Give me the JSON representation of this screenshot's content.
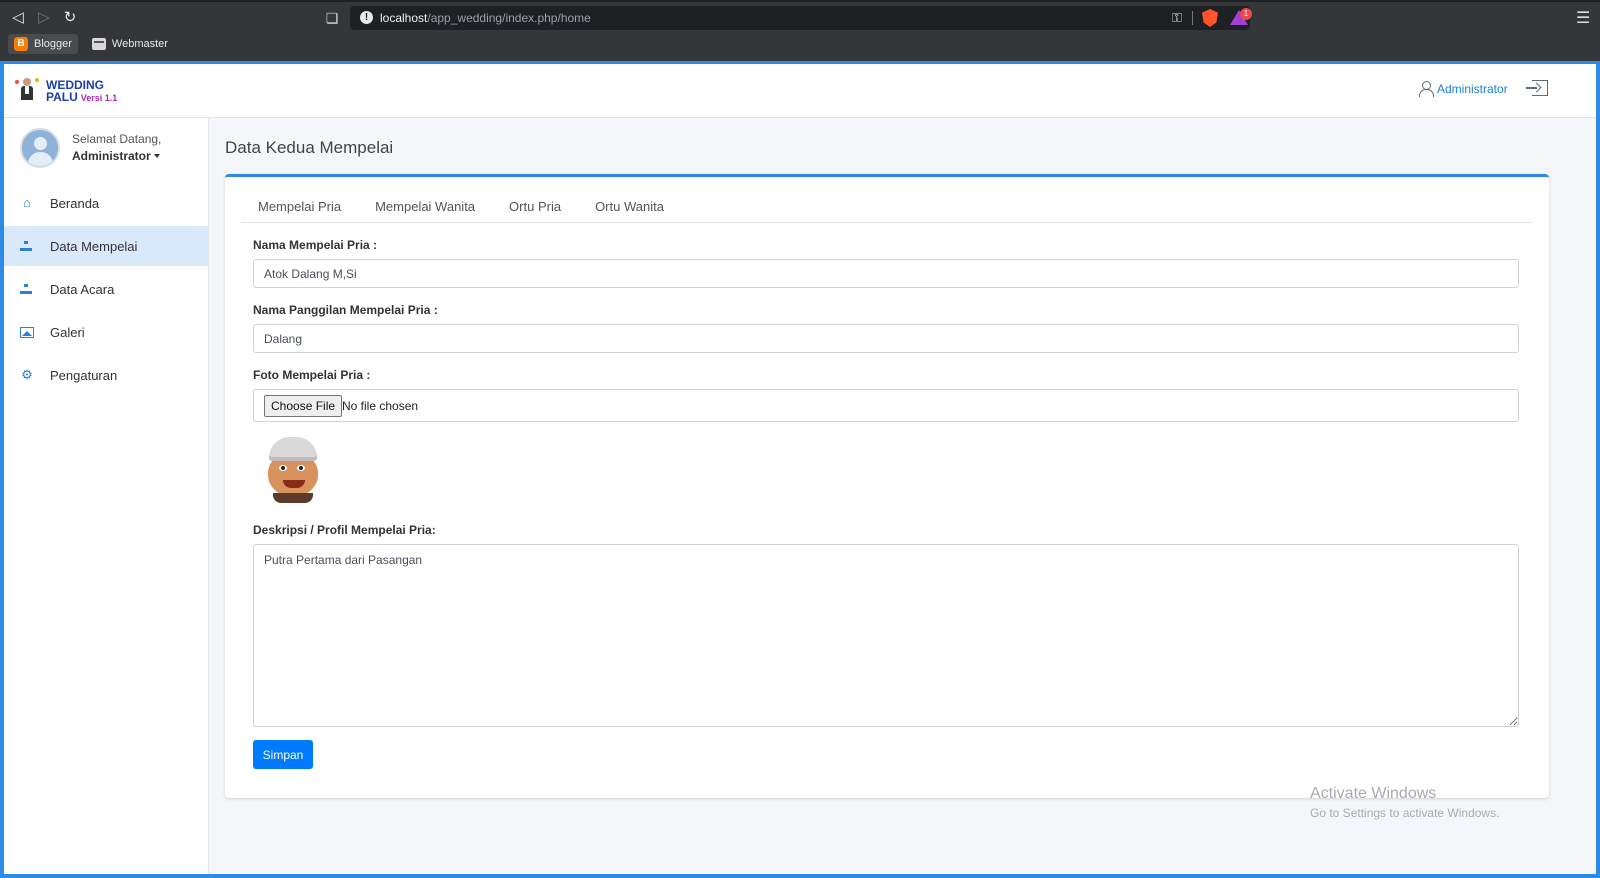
{
  "browser": {
    "url_host": "localhost",
    "url_path": "/app_wedding/index.php/home",
    "rewards_badge": "1",
    "bookmarks": [
      {
        "label": "Blogger"
      },
      {
        "label": "Webmaster"
      }
    ]
  },
  "app": {
    "logo": {
      "line1": "WEDDING",
      "line2": "PALU",
      "version": "Versi 1.1"
    },
    "top_user_label": "Administrator"
  },
  "sidebar": {
    "welcome": "Selamat Datang,",
    "user_name": "Administrator",
    "items": [
      {
        "label": "Beranda",
        "icon": "home-icon"
      },
      {
        "label": "Data Mempelai",
        "icon": "sitemap-icon",
        "active": true
      },
      {
        "label": "Data Acara",
        "icon": "sitemap-icon"
      },
      {
        "label": "Galeri",
        "icon": "image-icon"
      },
      {
        "label": "Pengaturan",
        "icon": "gear-icon"
      }
    ]
  },
  "page": {
    "title": "Data Kedua Mempelai",
    "tabs": [
      {
        "label": "Mempelai Pria"
      },
      {
        "label": "Mempelai Wanita"
      },
      {
        "label": "Ortu Pria"
      },
      {
        "label": "Ortu Wanita"
      }
    ],
    "form": {
      "name_label": "Nama Mempelai Pria :",
      "name_value": "Atok Dalang M,Si",
      "nickname_label": "Nama Panggilan Mempelai Pria :",
      "nickname_value": "Dalang",
      "photo_label": "Foto Mempelai Pria :",
      "file_button": "Choose File",
      "file_status": "No file chosen",
      "desc_label": "Deskripsi / Profil Mempelai Pria:",
      "desc_value": "Putra Pertama dari Pasangan",
      "save_label": "Simpan"
    }
  },
  "watermark": {
    "line1": "Activate Windows",
    "line2": "Go to Settings to activate Windows."
  },
  "colors": {
    "accent": "#2d8ae6",
    "primary_button": "#007bff",
    "active_menu_bg": "#dae8fc"
  }
}
